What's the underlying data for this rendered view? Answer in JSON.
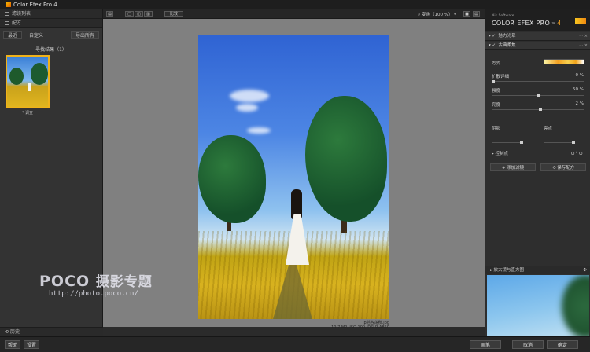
{
  "window": {
    "title": "Color Efex Pro 4"
  },
  "left_panel": {
    "header": "滤镜列表",
    "recipes_header": "配方",
    "tabs": [
      "最近",
      "自定义"
    ],
    "export_button": "导出所有",
    "results_label": "寻找结果（1）",
    "thumbnail_label": "* 调查",
    "history_header": "历史"
  },
  "toolbar": {
    "compare_button": "比较",
    "zoom_label": "变焦（100 %）"
  },
  "image": {
    "filename": "p稻谷荡秋.jpg",
    "info": "10.7 MP, ISO 100, DSLR-A850"
  },
  "watermark": {
    "brand": "POCO",
    "brand_cn": "摄影专题",
    "url": "http://photo.poco.cn/"
  },
  "right_panel": {
    "vendor": "Nik Software",
    "product": "COLOR EFEX PRO",
    "version": "4",
    "filters": [
      {
        "name": "魅力光晕",
        "enabled": true
      },
      {
        "name": "古典柔焦",
        "enabled": true
      }
    ],
    "controls": {
      "method_label": "方式",
      "diffuse_label": "扩散详细",
      "diffuse_value": "0 %",
      "strength_label": "强度",
      "strength_value": "50 %",
      "brightness_label": "亮度",
      "brightness_value": "2 %",
      "shadows_label": "阴影",
      "highlights_label": "亮点",
      "control_points_label": "控制点"
    },
    "add_filter_button": "+ 添加滤镜",
    "save_recipe_button": "保存配方",
    "loupe_header": "放大镜与直方图"
  },
  "bottom_bar": {
    "help_button": "帮助",
    "settings_button": "设置",
    "brush_button": "画笔",
    "cancel_button": "取消",
    "ok_button": "确定"
  },
  "colors": {
    "accent": "#f0b21a",
    "panel_bg": "#2e2e2e",
    "canvas_bg": "#808080"
  }
}
